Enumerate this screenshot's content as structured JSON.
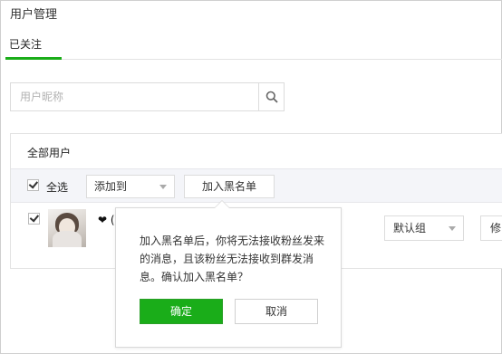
{
  "header": {
    "title": "用户管理"
  },
  "tabs": [
    {
      "label": "已关注",
      "active": true
    }
  ],
  "search": {
    "placeholder": "用户昵称",
    "icon": "search-icon"
  },
  "panel": {
    "title": "全部用户",
    "toolbar": {
      "select_all_label": "全选",
      "select_all_checked": true,
      "add_to_label": "添加到",
      "blacklist_label": "加入黑名单"
    },
    "users": [
      {
        "nickname": "❤ (",
        "checked": true,
        "group": "默认组",
        "action_partial": "修"
      }
    ]
  },
  "popover": {
    "message": "加入黑名单后，你将无法接收粉丝发来的消息，且该粉丝无法接收到群发消息。确认加入黑名单？",
    "confirm_label": "确定",
    "cancel_label": "取消"
  },
  "colors": {
    "accent": "#1aad19",
    "toolbar_bg": "#f4f5f9",
    "border": "#dcdcdc"
  }
}
